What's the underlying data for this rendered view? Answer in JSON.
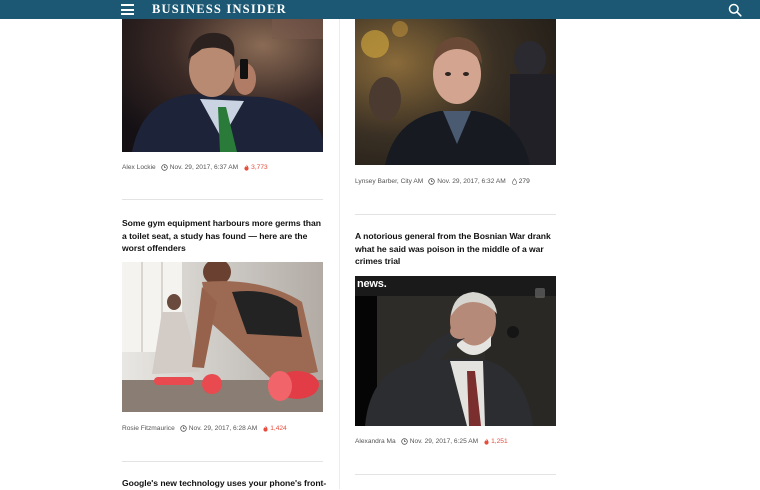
{
  "header": {
    "logo": "BUSINESS INSIDER",
    "bg_color": "#1c5873"
  },
  "left_column": [
    {
      "author": "Alex Lockie",
      "date": "Nov. 29, 2017, 6:37 AM",
      "views": "3,773",
      "hot": true
    },
    {
      "headline": "Some gym equipment harbours more germs than a toilet seat, a study has found — here are the worst offenders",
      "author": "Rosie Fitzmaurice",
      "date": "Nov. 29, 2017, 6:28 AM",
      "views": "1,424",
      "hot": true
    },
    {
      "headline": "Google's new technology uses your phone's front-"
    }
  ],
  "right_column": [
    {
      "author": "Lynsey Barber, City AM",
      "date": "Nov. 29, 2017, 6:32 AM",
      "views": "279",
      "hot": false
    },
    {
      "headline": "A notorious general from the Bosnian War drank what he said was poison in the middle of a war crimes trial",
      "image_caption": "news.",
      "author": "Alexandra Ma",
      "date": "Nov. 29, 2017, 6:25 AM",
      "views": "1,251",
      "hot": true
    }
  ],
  "colors": {
    "hot": "#e74c3c",
    "divider": "#e3e3e3"
  },
  "icons": [
    "hamburger-icon",
    "search-icon",
    "clock-icon",
    "flame-icon",
    "drop-icon"
  ]
}
